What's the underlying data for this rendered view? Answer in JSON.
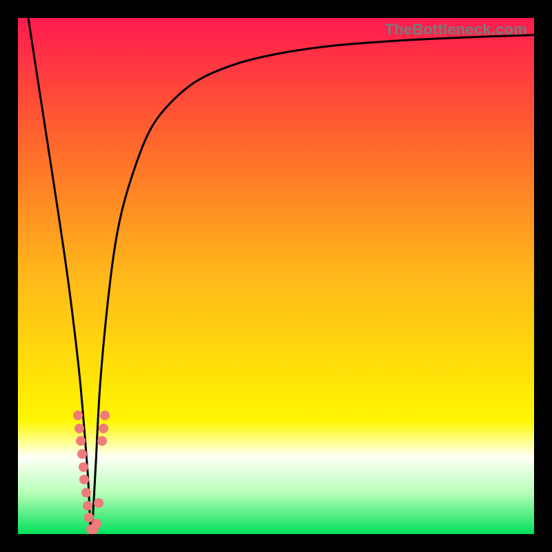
{
  "watermark": "TheBottleneck.com",
  "chart_data": {
    "type": "line",
    "title": "",
    "xlabel": "",
    "ylabel": "",
    "xlim": [
      0,
      100
    ],
    "ylim": [
      0,
      100
    ],
    "grid": false,
    "background_gradient": {
      "stops": [
        {
          "pct": 0,
          "color": "#ff1a4f"
        },
        {
          "pct": 25,
          "color": "#ff6a2b"
        },
        {
          "pct": 50,
          "color": "#ffb81a"
        },
        {
          "pct": 78,
          "color": "#fff600"
        },
        {
          "pct": 82,
          "color": "#ffff8a"
        },
        {
          "pct": 85,
          "color": "#fffff7"
        },
        {
          "pct": 92,
          "color": "#b8ffb8"
        },
        {
          "pct": 100,
          "color": "#00e05a"
        }
      ]
    },
    "series": [
      {
        "name": "bottleneck-curve",
        "color": "#000000",
        "x": [
          2,
          4,
          6,
          8,
          10,
          12,
          13.5,
          14.2,
          15,
          16,
          18,
          20,
          23,
          26,
          30,
          35,
          42,
          50,
          60,
          72,
          86,
          100
        ],
        "y": [
          100,
          87,
          74,
          61,
          47,
          30,
          12,
          0.5,
          12,
          30,
          50,
          62,
          72,
          79,
          84,
          88,
          91,
          93,
          94.5,
          95.5,
          96.2,
          96.7
        ]
      }
    ],
    "scatter": {
      "name": "highlight-dots",
      "color": "#ef7b7b",
      "points": [
        {
          "x": 11.6,
          "y": 23.0
        },
        {
          "x": 11.9,
          "y": 20.5
        },
        {
          "x": 12.1,
          "y": 18.0
        },
        {
          "x": 12.4,
          "y": 15.5
        },
        {
          "x": 12.7,
          "y": 13.0
        },
        {
          "x": 12.9,
          "y": 10.5
        },
        {
          "x": 13.2,
          "y": 8.0
        },
        {
          "x": 13.5,
          "y": 5.5
        },
        {
          "x": 13.8,
          "y": 3.2
        },
        {
          "x": 14.2,
          "y": 1.0
        },
        {
          "x": 14.7,
          "y": 1.0
        },
        {
          "x": 15.2,
          "y": 2.0
        },
        {
          "x": 15.7,
          "y": 6.0
        },
        {
          "x": 16.3,
          "y": 18.0
        },
        {
          "x": 16.6,
          "y": 20.5
        },
        {
          "x": 16.9,
          "y": 23.0
        }
      ]
    }
  }
}
